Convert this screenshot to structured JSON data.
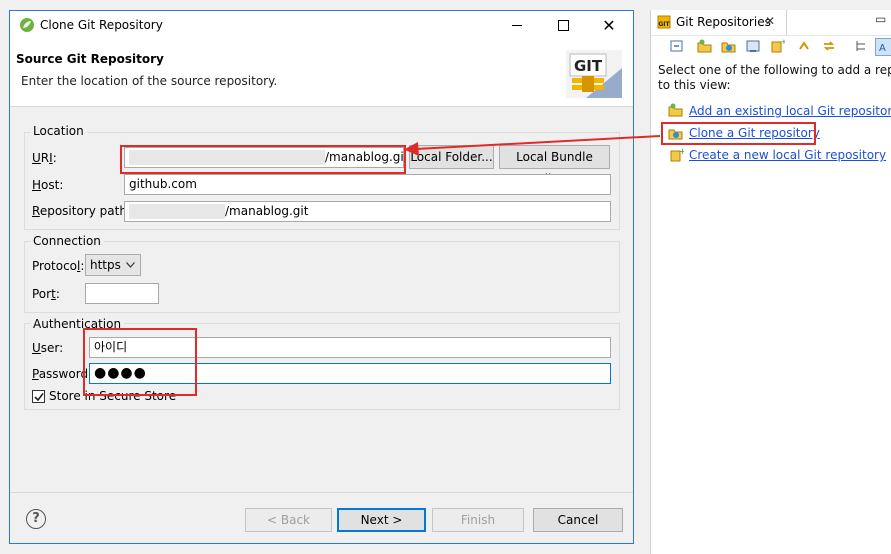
{
  "dialog": {
    "title": "Clone Git Repository",
    "header_title": "Source Git Repository",
    "header_desc": "Enter the location of the source repository.",
    "logo_text": "GIT",
    "location": {
      "group_title": "Location",
      "uri_label": "URI:",
      "uri_value": "/manablog.git",
      "local_folder_button": "Local Folder...",
      "local_bundle_button": "Local Bundle File...",
      "host_label": "Host:",
      "host_value": "github.com",
      "repo_path_label": "Repository path:",
      "repo_path_value": "/manablog.git"
    },
    "connection": {
      "group_title": "Connection",
      "protocol_label": "Protocol:",
      "protocol_value": "https",
      "port_label": "Port:",
      "port_value": ""
    },
    "authentication": {
      "group_title": "Authentication",
      "user_label": "User:",
      "user_value": "아이디",
      "password_label": "Password:",
      "password_value": "●●●●",
      "store_label": "Store in Secure Store",
      "store_checked": true
    },
    "buttons": {
      "back": "< Back",
      "next": "Next >",
      "finish": "Finish",
      "cancel": "Cancel"
    }
  },
  "view": {
    "tab_label": "Git Repositories",
    "message": "Select one of the following to add a reposit to this view:",
    "message_line1": "Select one of the following to add a reposit",
    "message_line2": "to this view:",
    "links": [
      {
        "label": "Add an existing local Git repository",
        "icon": "folder-add-icon"
      },
      {
        "label": "Clone a Git repository",
        "icon": "clone-icon"
      },
      {
        "label": "Create a new local Git repository",
        "icon": "create-repo-icon"
      }
    ]
  },
  "colors": {
    "accent": "#0078d7",
    "annotation_red": "#e02b2b",
    "link_blue": "#1a4fd6"
  }
}
